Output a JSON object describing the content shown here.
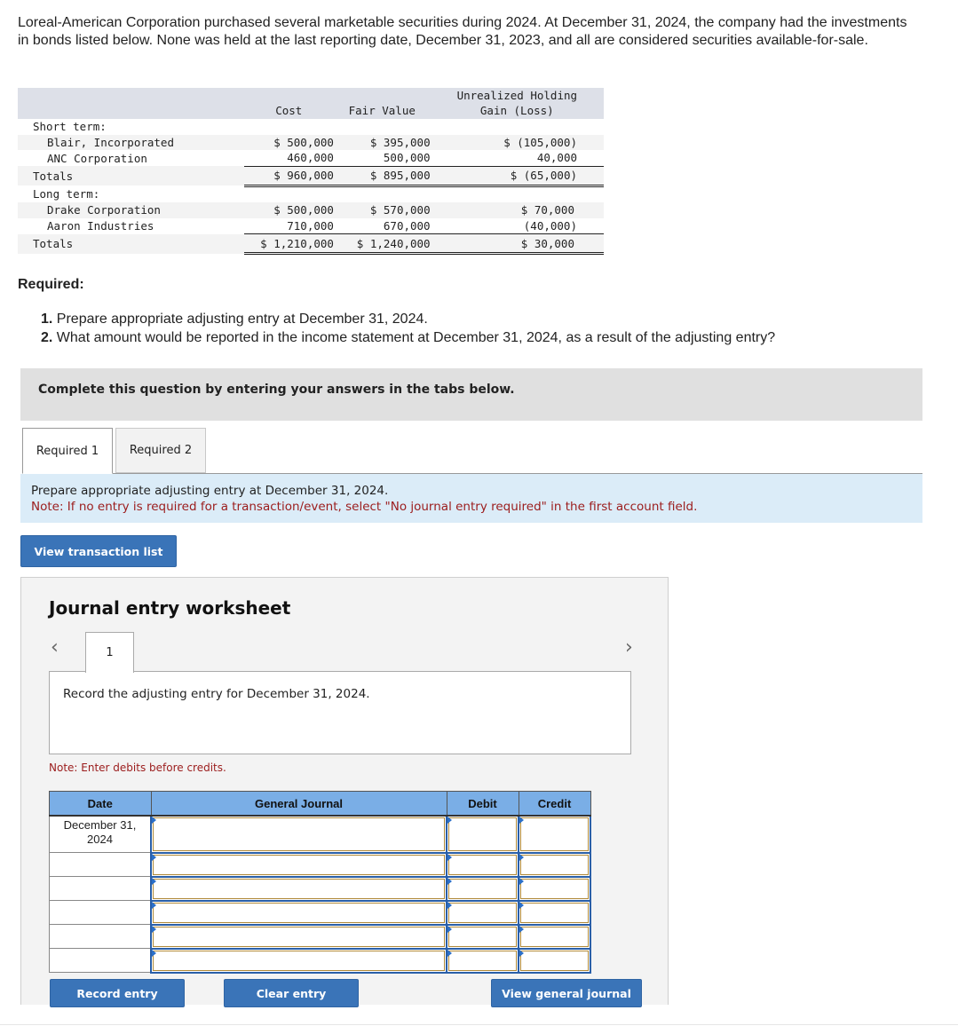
{
  "intro_text": "Loreal-American Corporation purchased several marketable securities during 2024. At December 31, 2024, the company had the investments in bonds listed below. None was held at the last reporting date, December 31, 2023, and all are considered securities available-for-sale.",
  "securities_table": {
    "headers": {
      "cost": "Cost",
      "fair_value": "Fair Value",
      "gain_line1": "Unrealized Holding",
      "gain_line2": "Gain (Loss)"
    },
    "short_term": {
      "label": "Short term:",
      "rows": [
        {
          "name": "Blair, Incorporated",
          "cost": "$ 500,000",
          "fair_value": "$ 395,000",
          "gain": "$ (105,000)"
        },
        {
          "name": "ANC Corporation",
          "cost": "460,000",
          "fair_value": "500,000",
          "gain": "40,000"
        }
      ],
      "totals": {
        "label": "Totals",
        "cost": "$ 960,000",
        "fair_value": "$ 895,000",
        "gain": "$ (65,000)"
      }
    },
    "long_term": {
      "label": "Long term:",
      "rows": [
        {
          "name": "Drake Corporation",
          "cost": "$ 500,000",
          "fair_value": "$ 570,000",
          "gain": "$ 70,000"
        },
        {
          "name": "Aaron Industries",
          "cost": "710,000",
          "fair_value": "670,000",
          "gain": "(40,000)"
        }
      ],
      "totals": {
        "label": "Totals",
        "cost": "$ 1,210,000",
        "fair_value": "$ 1,240,000",
        "gain": "$ 30,000"
      }
    }
  },
  "required": {
    "heading": "Required:",
    "items": [
      {
        "num": "1.",
        "text": " Prepare appropriate adjusting entry at December 31, 2024."
      },
      {
        "num": "2.",
        "text": " What amount would be reported in the income statement at December 31, 2024, as a result of the adjusting entry?"
      }
    ]
  },
  "banner_text": "Complete this question by entering your answers in the tabs below.",
  "tabs": [
    {
      "label": "Required 1",
      "active": true
    },
    {
      "label": "Required 2",
      "active": false
    }
  ],
  "instructions": {
    "line1": "Prepare appropriate adjusting entry at December 31, 2024.",
    "note": "Note: If no entry is required for a transaction/event, select \"No journal entry required\" in the first account field."
  },
  "buttons": {
    "view_transaction_list": "View transaction list",
    "record_entry": "Record entry",
    "clear_entry": "Clear entry",
    "view_general_journal": "View general journal"
  },
  "worksheet": {
    "title": "Journal entry worksheet",
    "prev_icon": "‹",
    "next_icon": "›",
    "entry_tab": "1",
    "prompt": "Record the adjusting entry for December 31, 2024.",
    "note": "Note: Enter debits before credits.",
    "table": {
      "headers": {
        "date": "Date",
        "general_journal": "General Journal",
        "debit": "Debit",
        "credit": "Credit"
      },
      "rows": [
        {
          "date_line1": "December 31,",
          "date_line2": "2024",
          "account": "",
          "debit": "",
          "credit": ""
        },
        {
          "date_line1": "",
          "date_line2": "",
          "account": "",
          "debit": "",
          "credit": ""
        },
        {
          "date_line1": "",
          "date_line2": "",
          "account": "",
          "debit": "",
          "credit": ""
        },
        {
          "date_line1": "",
          "date_line2": "",
          "account": "",
          "debit": "",
          "credit": ""
        },
        {
          "date_line1": "",
          "date_line2": "",
          "account": "",
          "debit": "",
          "credit": ""
        },
        {
          "date_line1": "",
          "date_line2": "",
          "account": "",
          "debit": "",
          "credit": ""
        }
      ]
    }
  },
  "colors": {
    "header_blue": "#7aaee6",
    "button_blue": "#3a74b8",
    "note_red": "#9b1c1c",
    "instruction_bg": "#dbecf8",
    "banner_gray": "#e0e0e0"
  }
}
